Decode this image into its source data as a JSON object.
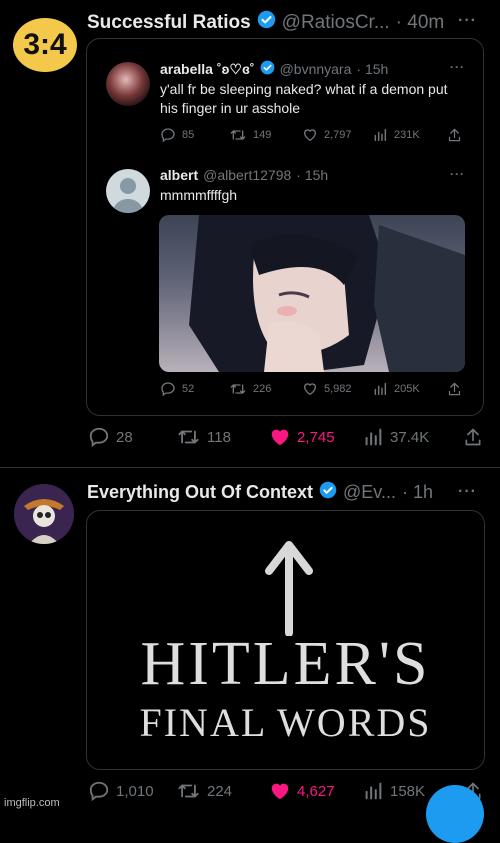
{
  "tweet1": {
    "avatar_text": "3:4",
    "name": "Successful Ratios",
    "handle": "@RatiosCr...",
    "time": "· 40m",
    "more": "···",
    "stats": {
      "replies": "28",
      "retweets": "118",
      "likes": "2,745",
      "views": "37.4K"
    }
  },
  "quote1": {
    "name": "arabella ˚ʚ♡ɞ˚",
    "handle": "@bvnnyara",
    "time": "· 15h",
    "more": "···",
    "text": "y'all fr be sleeping naked? what if a demon put his finger in ur asshole",
    "stats": {
      "replies": "85",
      "retweets": "149",
      "likes": "2,797",
      "views": "231K"
    }
  },
  "reply1": {
    "name": "albert",
    "handle": "@albert12798",
    "time": "· 15h",
    "more": "···",
    "text": "mmmmffffgh",
    "stats": {
      "replies": "52",
      "retweets": "226",
      "likes": "5,982",
      "views": "205K"
    }
  },
  "tweet2": {
    "name": "Everything Out Of Context",
    "handle": "@Ev...",
    "time": "· 1h",
    "more": "···",
    "image_line1": "HITLER'S",
    "image_line2": "FINAL WORDS",
    "stats": {
      "replies": "1,010",
      "retweets": "224",
      "likes": "4,627",
      "views": "158K"
    }
  },
  "watermark": "imgflip.com",
  "colors": {
    "verified": "#1d9bf0",
    "like": "#f91880",
    "avatar_gold": "#f3c84b"
  }
}
